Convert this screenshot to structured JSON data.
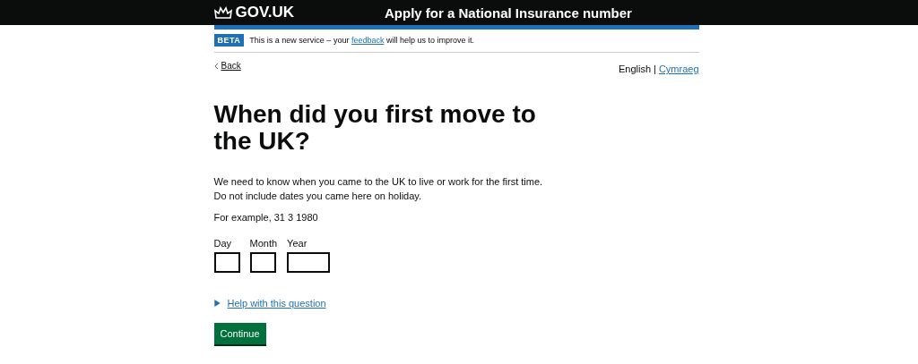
{
  "header": {
    "logo": "GOV.UK",
    "service_name": "Apply for a National Insurance number"
  },
  "phase_banner": {
    "tag": "BETA",
    "text_before": "This is a new service – your",
    "link": "feedback",
    "text_after": "will help us to improve it."
  },
  "back_link": "Back",
  "languages": [
    {
      "label": "English",
      "selected": true
    },
    {
      "label": "Cymraeg",
      "selected": false
    }
  ],
  "separator": "|",
  "heading": "When did you first move to the UK?",
  "hint": [
    "We need to know when you came to the UK to live or work for the first time.",
    "Do not include dates you came here on holiday."
  ],
  "example": "For example, 31 3 1980",
  "date_fields": [
    {
      "label": "Day",
      "kind": "short"
    },
    {
      "label": "Month",
      "kind": "short"
    },
    {
      "label": "Year",
      "kind": "long"
    }
  ],
  "help": {
    "label": "Help with this question",
    "expanded": false
  },
  "button": "Continue"
}
